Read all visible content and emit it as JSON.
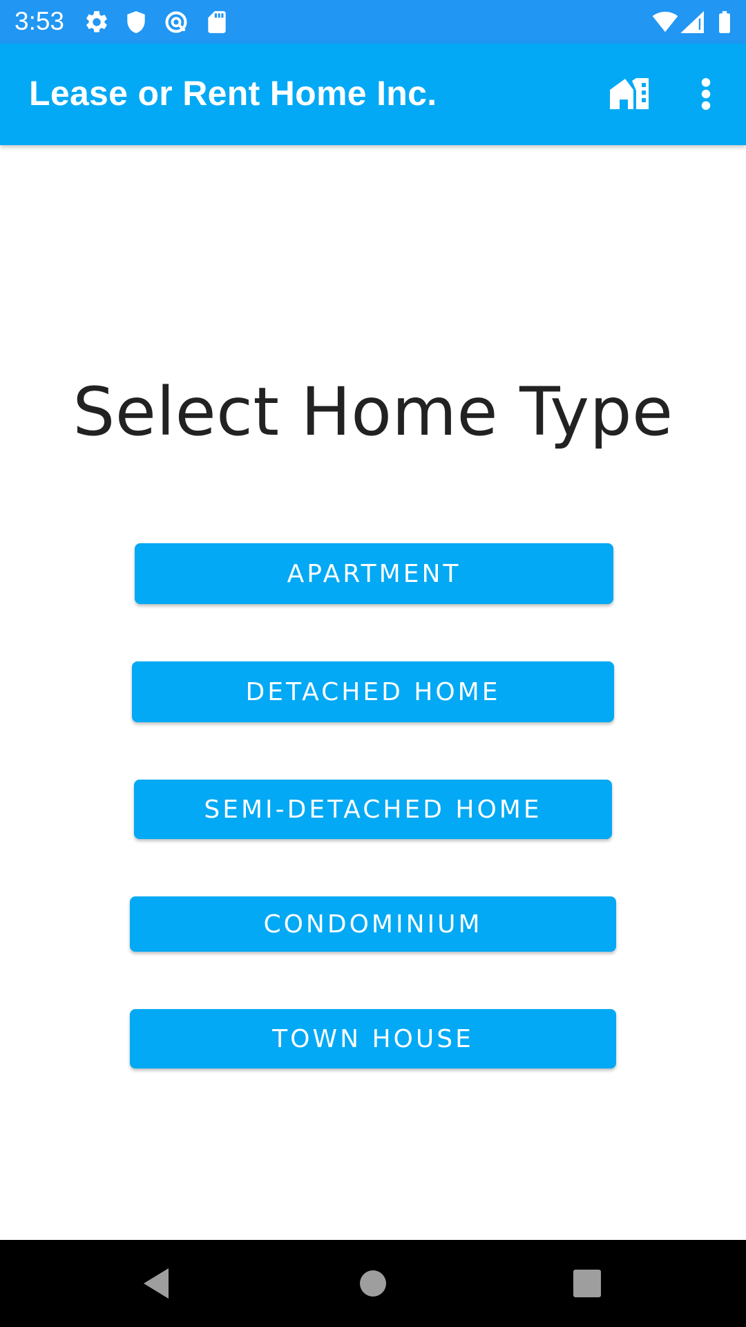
{
  "status_bar": {
    "time": "3:53",
    "left_icons": [
      "settings-icon",
      "shield-icon",
      "vpn-key-icon",
      "sd-card-icon"
    ],
    "right_icons": [
      "wifi-icon",
      "signal-icon",
      "battery-icon"
    ]
  },
  "app_bar": {
    "title": "Lease or Rent Home Inc.",
    "actions": [
      "homes-icon",
      "more-vert-icon"
    ]
  },
  "main": {
    "heading": "Select Home Type",
    "buttons": [
      {
        "label": "APARTMENT"
      },
      {
        "label": "DETACHED HOME"
      },
      {
        "label": "SEMI-DETACHED HOME"
      },
      {
        "label": "CONDOMINIUM"
      },
      {
        "label": "TOWN HOUSE"
      }
    ]
  },
  "nav_bar": {
    "buttons": [
      "back-icon",
      "home-icon",
      "recents-icon"
    ]
  },
  "colors": {
    "status_bar": "#2196f3",
    "app_bar": "#03a9f4",
    "button": "#03a9f4",
    "button_text": "#ffffff",
    "heading_text": "#222222",
    "nav_bar": "#000000"
  }
}
